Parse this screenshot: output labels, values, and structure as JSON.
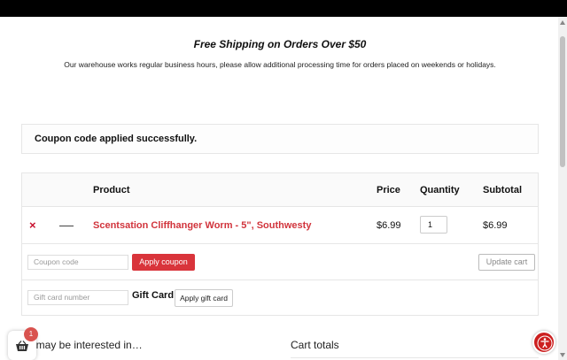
{
  "promo": {
    "title": "Free Shipping on Orders Over $50",
    "text": "Our warehouse works regular business hours, please allow additional processing time for orders placed on weekends or holidays."
  },
  "notice": {
    "message": "Coupon code applied successfully."
  },
  "cart": {
    "headers": {
      "product": "Product",
      "price": "Price",
      "quantity": "Quantity",
      "subtotal": "Subtotal"
    },
    "items": [
      {
        "remove": "×",
        "name": "Scentsation Cliffhanger Worm - 5\", Southwesty",
        "price": "$6.99",
        "quantity": "1",
        "subtotal": "$6.99"
      }
    ],
    "coupon": {
      "placeholder": "Coupon code",
      "apply_label": "Apply coupon",
      "update_label": "Update cart"
    },
    "gift": {
      "placeholder": "Gift card number",
      "label": "Gift Card:",
      "apply_label": "Apply gift card"
    }
  },
  "sections": {
    "interested": "ı may be interested in…",
    "cart_totals": "Cart totals"
  },
  "mini_cart": {
    "count": "1",
    "icon": "basket-icon"
  },
  "accessibility": {
    "icon": "accessibility-icon"
  },
  "colors": {
    "accent": "#d9343b",
    "link": "#d1343c",
    "topbar": "#000000"
  }
}
